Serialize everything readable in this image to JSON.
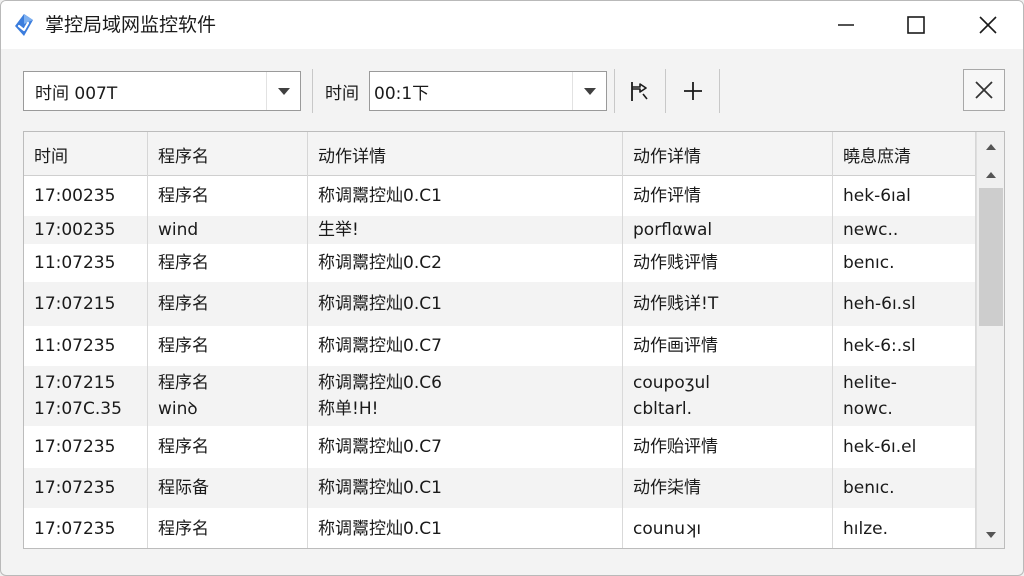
{
  "window": {
    "title": "掌控局域网监控软件",
    "accent": "#3b7ddd"
  },
  "toolbar": {
    "select1_value": "时间 007T",
    "label2": "时间",
    "select2_value": "00:1下"
  },
  "table": {
    "headers": [
      "时间",
      "程序名",
      "动作详情",
      "动作详情",
      "曉息庶清"
    ],
    "rows": [
      {
        "lines": [
          [
            "17:00235",
            "程序名",
            "称调鬻控灿0.C1",
            "动作评情",
            "hek-6ıal"
          ]
        ]
      },
      {
        "lines": [
          [
            "17:00235",
            "wind",
            "生举!",
            "porflαwal",
            "newc.."
          ]
        ]
      },
      {
        "lines": [
          [
            "11:07235",
            "程序名",
            "称调鬻控灿0.C2",
            "动作贱评情",
            "benıc."
          ]
        ]
      },
      {
        "lines": [
          [
            "17:07215",
            "程序名",
            "称调鬻控灿0.C1",
            "动作贱详!T",
            "heh-6ı.sl"
          ]
        ]
      },
      {
        "lines": [
          [
            "11:07235",
            "程序名",
            "称调鬻控灿0.C7",
            "动作画评情",
            "hek-6:.sl"
          ]
        ]
      },
      {
        "lines": [
          [
            "17:07215",
            "程序名",
            "称调鬻控灿0.C6",
            "coupoʒul",
            "helite-"
          ],
          [
            "17:07C.35",
            "winꝺ",
            "称单!H!",
            "cbltarl.",
            "nowc."
          ]
        ]
      },
      {
        "lines": [
          [
            "17:07235",
            "程序名",
            "称调鬻控灿0.C7",
            "动作贻评情",
            "hek-6ı.el"
          ]
        ]
      },
      {
        "lines": [
          [
            "17:07235",
            "程际备",
            "称调鬻控灿0.C1",
            "动作柒情",
            "benıc."
          ]
        ]
      },
      {
        "lines": [
          [
            "17:07235",
            "程序名",
            "称调鬻控灿0.C1",
            "counuʞı",
            "hılze."
          ]
        ]
      }
    ]
  },
  "icons": {
    "app": "app-logo-icon",
    "minimize": "minimize-icon",
    "maximize": "maximize-icon",
    "close": "close-icon",
    "dropdown": "chevron-down-icon",
    "flag": "flag-icon",
    "add": "plus-icon",
    "clear": "x-icon",
    "scroll_up": "scroll-up-icon",
    "scroll_down": "scroll-down-icon"
  }
}
